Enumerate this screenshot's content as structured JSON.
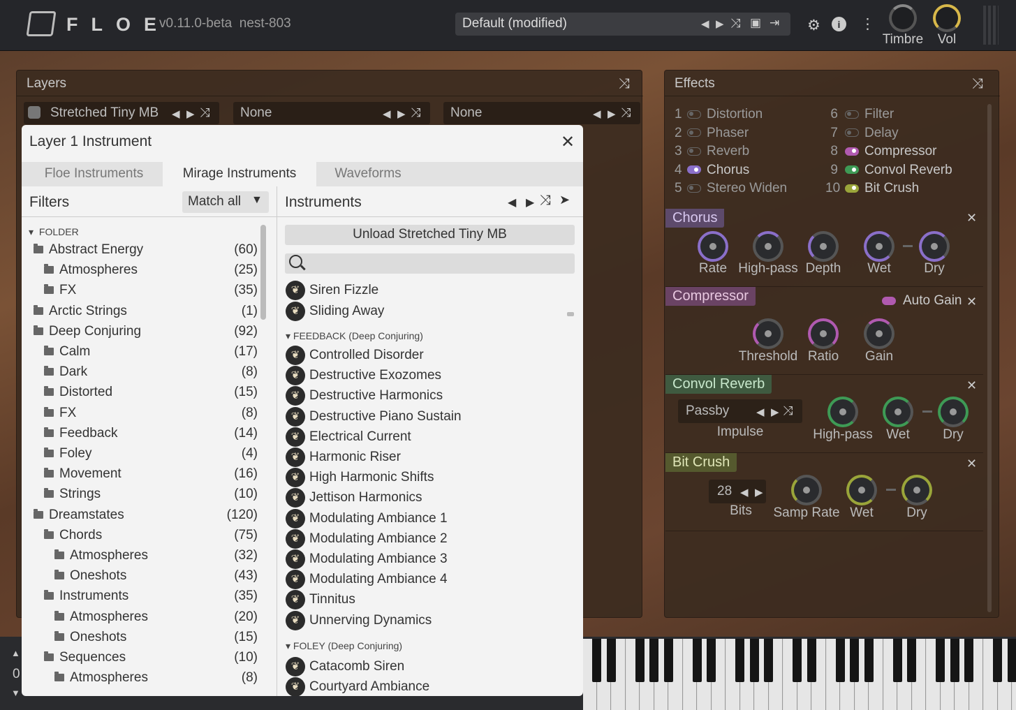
{
  "app": {
    "logo": "FLOE",
    "version": "v0.11.0-beta",
    "build": "nest-803",
    "preset": "Default (modified)"
  },
  "top_knobs": {
    "timbre": "Timbre",
    "vol": "Vol"
  },
  "layers": {
    "title": "Layers",
    "slots": [
      "Stretched Tiny MB",
      "None",
      "None"
    ]
  },
  "effects": {
    "title": "Effects",
    "list": [
      {
        "num": "1",
        "name": "Distortion",
        "on": false
      },
      {
        "num": "2",
        "name": "Phaser",
        "on": false
      },
      {
        "num": "3",
        "name": "Reverb",
        "on": false
      },
      {
        "num": "4",
        "name": "Chorus",
        "on": true,
        "color": "#8a6fc9"
      },
      {
        "num": "5",
        "name": "Stereo Widen",
        "on": false
      },
      {
        "num": "6",
        "name": "Filter",
        "on": false
      },
      {
        "num": "7",
        "name": "Delay",
        "on": false
      },
      {
        "num": "8",
        "name": "Compressor",
        "on": true,
        "color": "#b05ab0"
      },
      {
        "num": "9",
        "name": "Convol Reverb",
        "on": true,
        "color": "#3e9a55"
      },
      {
        "num": "10",
        "name": "Bit Crush",
        "on": true,
        "color": "#9aa53a"
      }
    ],
    "chorus": {
      "title": "Chorus",
      "knobs": [
        "Rate",
        "High-pass",
        "Depth",
        "Wet",
        "Dry"
      ]
    },
    "compressor": {
      "title": "Compressor",
      "auto_gain": "Auto Gain",
      "knobs": [
        "Threshold",
        "Ratio",
        "Gain"
      ]
    },
    "convol": {
      "title": "Convol Reverb",
      "impulse_value": "Passby",
      "impulse_label": "Impulse",
      "knobs": [
        "High-pass",
        "Wet",
        "Dry"
      ]
    },
    "bitcrush": {
      "title": "Bit Crush",
      "bits_value": "28",
      "bits_label": "Bits",
      "knobs": [
        "Samp Rate",
        "Wet",
        "Dry"
      ]
    }
  },
  "modal": {
    "title": "Layer 1 Instrument",
    "tabs": [
      "Floe Instruments",
      "Mirage Instruments",
      "Waveforms"
    ],
    "filters_label": "Filters",
    "match_label": "Match all",
    "folder_header": "FOLDER",
    "folders": [
      {
        "name": "Abstract Energy",
        "count": "(60)",
        "level": 0
      },
      {
        "name": "Atmospheres",
        "count": "(25)",
        "level": 1
      },
      {
        "name": "FX",
        "count": "(35)",
        "level": 1
      },
      {
        "name": "Arctic Strings",
        "count": "(1)",
        "level": 0
      },
      {
        "name": "Deep Conjuring",
        "count": "(92)",
        "level": 0
      },
      {
        "name": "Calm",
        "count": "(17)",
        "level": 1
      },
      {
        "name": "Dark",
        "count": "(8)",
        "level": 1
      },
      {
        "name": "Distorted",
        "count": "(15)",
        "level": 1
      },
      {
        "name": "FX",
        "count": "(8)",
        "level": 1
      },
      {
        "name": "Feedback",
        "count": "(14)",
        "level": 1
      },
      {
        "name": "Foley",
        "count": "(4)",
        "level": 1
      },
      {
        "name": "Movement",
        "count": "(16)",
        "level": 1
      },
      {
        "name": "Strings",
        "count": "(10)",
        "level": 1
      },
      {
        "name": "Dreamstates",
        "count": "(120)",
        "level": 0
      },
      {
        "name": "Chords",
        "count": "(75)",
        "level": 1
      },
      {
        "name": "Atmospheres",
        "count": "(32)",
        "level": 2
      },
      {
        "name": "Oneshots",
        "count": "(43)",
        "level": 2
      },
      {
        "name": "Instruments",
        "count": "(35)",
        "level": 1
      },
      {
        "name": "Atmospheres",
        "count": "(20)",
        "level": 2
      },
      {
        "name": "Oneshots",
        "count": "(15)",
        "level": 2
      },
      {
        "name": "Sequences",
        "count": "(10)",
        "level": 1
      },
      {
        "name": "Atmospheres",
        "count": "(8)",
        "level": 2
      }
    ],
    "instruments_label": "Instruments",
    "unload_label": "Unload Stretched Tiny MB",
    "top_items": [
      "Siren Fizzle",
      "Sliding Away"
    ],
    "group1": "FEEDBACK (Deep Conjuring)",
    "group1_items": [
      "Controlled Disorder",
      "Destructive Exozomes",
      "Destructive Harmonics",
      "Destructive Piano Sustain",
      "Electrical Current",
      "Harmonic Riser",
      "High Harmonic Shifts",
      "Jettison Harmonics",
      "Modulating Ambiance 1",
      "Modulating Ambiance 2",
      "Modulating Ambiance 3",
      "Modulating Ambiance 4",
      "Tinnitus",
      "Unnerving Dynamics"
    ],
    "group2": "FOLEY (Deep Conjuring)",
    "group2_items": [
      "Catacomb Siren",
      "Courtyard Ambiance"
    ]
  },
  "keyboard": {
    "octave": "0"
  }
}
